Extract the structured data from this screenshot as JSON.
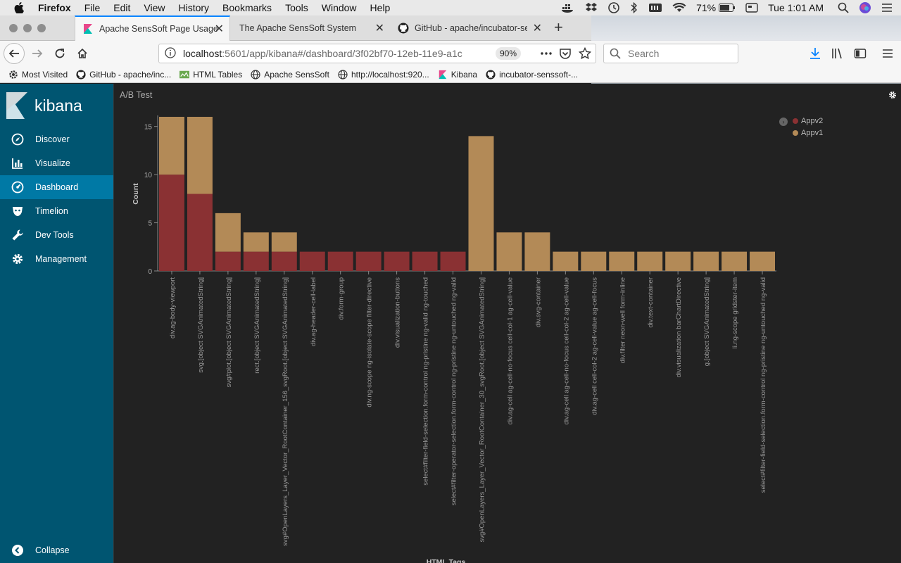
{
  "menubar": {
    "app": "Firefox",
    "items": [
      "File",
      "Edit",
      "View",
      "History",
      "Bookmarks",
      "Tools",
      "Window",
      "Help"
    ],
    "battery": "71%",
    "clock": "Tue 1:01 AM"
  },
  "tabs": [
    {
      "title": "Apache SensSoft Page Usage D",
      "active": true,
      "icon": "kibana-icon"
    },
    {
      "title": "The Apache SensSoft System",
      "active": false,
      "icon": "none"
    },
    {
      "title": "GitHub - apache/incubator-sen",
      "active": false,
      "icon": "github-icon"
    }
  ],
  "nav": {
    "url_host": "localhost",
    "url_rest": ":5601/app/kibana#/dashboard/3f02bf70-12eb-11e9-a1c",
    "zoom": "90%",
    "search_placeholder": "Search"
  },
  "bookmarks": [
    {
      "label": "Most Visited",
      "icon": "gear-icon"
    },
    {
      "label": "GitHub - apache/inc...",
      "icon": "github-icon"
    },
    {
      "label": "HTML Tables",
      "icon": "tables-icon"
    },
    {
      "label": "Apache SensSoft",
      "icon": "globe-icon"
    },
    {
      "label": "http://localhost:920...",
      "icon": "globe-icon"
    },
    {
      "label": "Kibana",
      "icon": "kibana-icon"
    },
    {
      "label": "incubator-senssoft-...",
      "icon": "github-icon"
    }
  ],
  "sidebar": {
    "brand": "kibana",
    "items": [
      {
        "label": "Discover",
        "icon": "compass-icon",
        "active": false
      },
      {
        "label": "Visualize",
        "icon": "bar-chart-icon",
        "active": false
      },
      {
        "label": "Dashboard",
        "icon": "dashboard-icon",
        "active": true
      },
      {
        "label": "Timelion",
        "icon": "timelion-icon",
        "active": false
      },
      {
        "label": "Dev Tools",
        "icon": "wrench-icon",
        "active": false
      },
      {
        "label": "Management",
        "icon": "gear-icon",
        "active": false
      }
    ],
    "collapse": "Collapse"
  },
  "panel": {
    "title": "A/B Test"
  },
  "colors": {
    "appv2": "#8a3133",
    "appv1": "#b38a57",
    "sidebar": "#005571",
    "sidebar_active": "#0079a5"
  },
  "chart_data": {
    "type": "bar",
    "stacked": true,
    "ylabel": "Count",
    "xlabel": "HTML Tags",
    "ylim": [
      0,
      16
    ],
    "yticks": [
      0,
      5,
      10,
      15
    ],
    "legend_position": "top-right",
    "categories": [
      "div.ag-body-viewport",
      "svg.[object SVGAnimatedString]",
      "svg#plot.[object SVGAnimatedString]",
      "rect.[object SVGAnimatedString]",
      "svg#OpenLayers_Layer_Vector_RootContainer_156_svgRoot.[object SVGAnimatedString]",
      "div.ag-header-cell-label",
      "div.form-group",
      "div.ng-scope ng-isolate-scope filter-directive",
      "div.visualization-buttons",
      "select#filter-field-selection.form-control ng-pristine ng-valid ng-touched",
      "select#filter-operator-selection.form-control ng-pristine ng-untouched ng-valid",
      "svg#OpenLayers_Layer_Vector_RootContainer_30_svgRoot.[object SVGAnimatedString]",
      "div.ag-cell ag-cell-no-focus cell-col-1 ag-cell-value",
      "div.svg-container",
      "div.ag-cell ag-cell-no-focus cell-col-2 ag-cell-value",
      "div.ag-cell cell-col-2 ag-cell-value ag-cell-focus",
      "div.filter neon-well form-inline",
      "div.text-container",
      "div.visualization barChartDirective",
      "g.[object SVGAnimatedString]",
      "li.ng-scope gridster-item",
      "select#filter-field-selection.form-control ng-pristine ng-untouched ng-valid"
    ],
    "series": [
      {
        "name": "Appv2",
        "values": [
          10,
          8,
          2,
          2,
          2,
          2,
          2,
          2,
          2,
          2,
          2,
          0,
          0,
          0,
          0,
          0,
          0,
          0,
          0,
          0,
          0,
          0
        ]
      },
      {
        "name": "Appv1",
        "values": [
          6,
          8,
          4,
          2,
          2,
          0,
          0,
          0,
          0,
          0,
          0,
          14,
          4,
          4,
          2,
          2,
          2,
          2,
          2,
          2,
          2,
          2
        ]
      }
    ]
  }
}
